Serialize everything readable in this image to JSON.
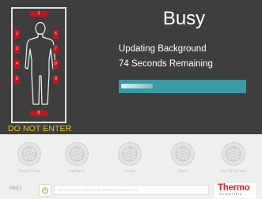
{
  "status": {
    "title": "Busy",
    "message": "Updating Background",
    "remaining": "74 Seconds Remaining",
    "progress_percent": 30
  },
  "portal": {
    "warning": "DO NOT ENTER",
    "sensor_color": "#c4161c",
    "sensors": {
      "top": "1",
      "left": [
        "2",
        "3",
        "4",
        "5"
      ],
      "right": [
        "6",
        "7",
        "8",
        "9"
      ],
      "bottom": "8"
    }
  },
  "controls": [
    {
      "label": "Ready/Clear",
      "icon": "film-reel-icon"
    },
    {
      "label": "Backgnd",
      "icon": "film-reel-icon"
    },
    {
      "label": "Count",
      "icon": "film-reel-icon"
    },
    {
      "label": "Alarm",
      "icon": "film-reel-icon"
    },
    {
      "label": "Out Of Service",
      "icon": "film-reel-icon"
    }
  ],
  "footer": {
    "unit_id": "PM12",
    "message": "Monitoring the background radiation measurement",
    "logo_word": "Thermo",
    "logo_sub": "SCIENTIFIC",
    "brand_color": "#d7262b"
  },
  "colors": {
    "panel": "#3e3e3e",
    "progress": "#3a9aa6",
    "warning": "#e8c320"
  }
}
